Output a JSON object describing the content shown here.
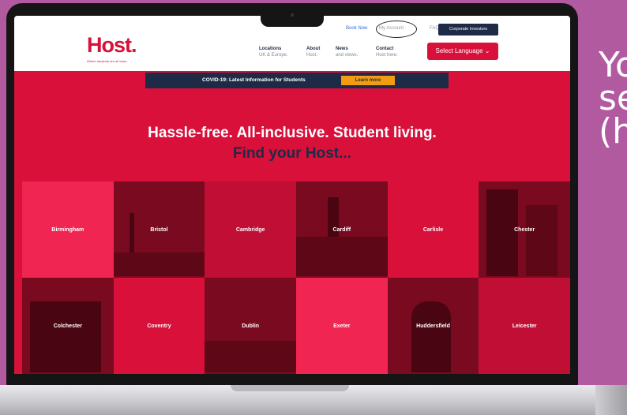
{
  "side_text": "Yo\nse\n(h",
  "header": {
    "logo": "Host.",
    "tagline": "Where students are at home.",
    "top_links": [
      "Book Now",
      "My Account",
      "FAQs"
    ],
    "corporate_button": "Corporate Investors",
    "nav": [
      {
        "title": "Locations",
        "sub": "UK & Europe."
      },
      {
        "title": "About",
        "sub": "Host."
      },
      {
        "title": "News",
        "sub": "and views."
      },
      {
        "title": "Contact",
        "sub": "Host here."
      }
    ],
    "language_button": "Select Language ⌄"
  },
  "covid": {
    "text": "COVID-19: Latest Information for Students",
    "button": "Learn more"
  },
  "hero": {
    "title": "Hassle-free. All-inclusive. Student living.",
    "subtitle": "Find your Host..."
  },
  "cities": [
    "Birmingham",
    "Bristol",
    "Cambridge",
    "Cardiff",
    "Carlisle",
    "Chester",
    "Colchester",
    "Coventry",
    "Dublin",
    "Exeter",
    "Huddersfield",
    "Leicester"
  ]
}
